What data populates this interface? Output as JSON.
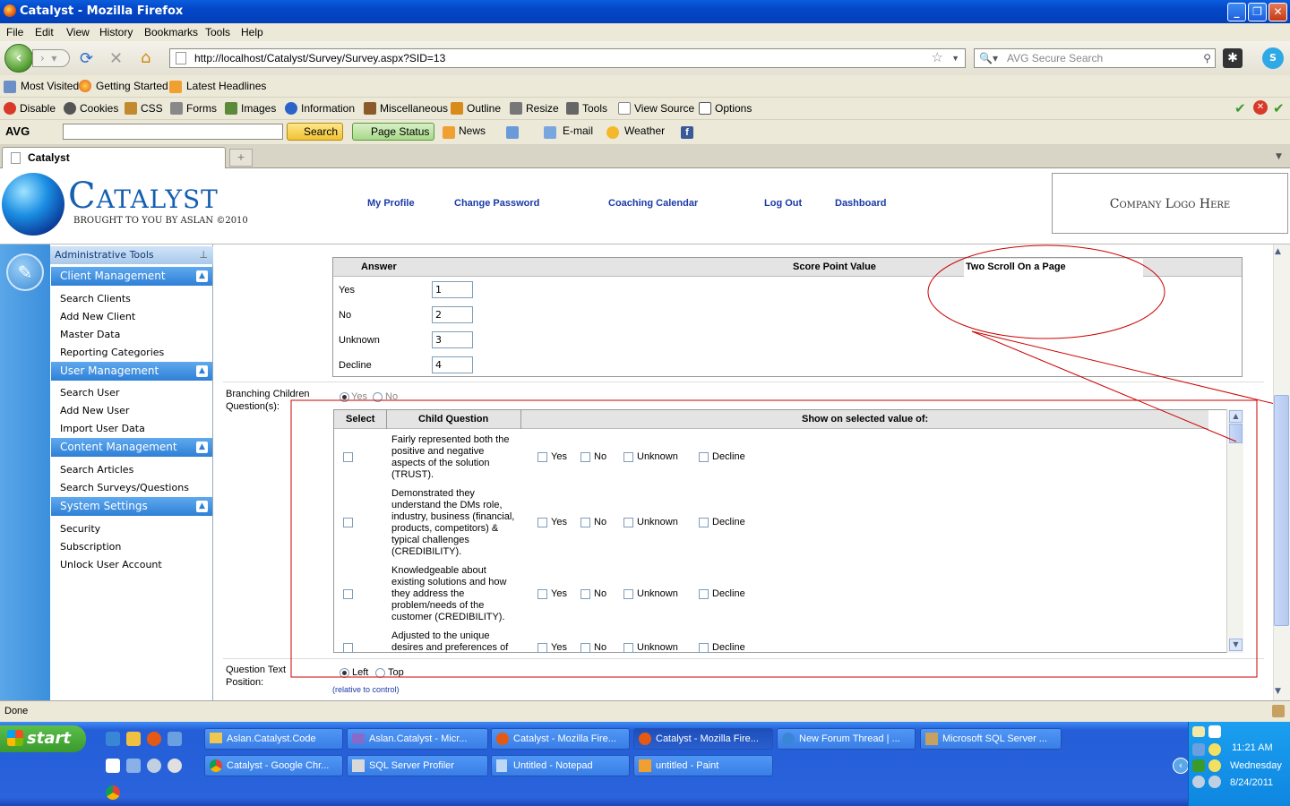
{
  "window": {
    "title": "Catalyst - Mozilla Firefox"
  },
  "menu": [
    "File",
    "Edit",
    "View",
    "History",
    "Bookmarks",
    "Tools",
    "Help"
  ],
  "nav": {
    "url": "http://localhost/Catalyst/Survey/Survey.aspx?SID=13",
    "search_placeholder": "AVG Secure Search"
  },
  "bookmarks": [
    "Most Visited",
    "Getting Started",
    "Latest Headlines"
  ],
  "devtoolbar": [
    "Disable",
    "Cookies",
    "CSS",
    "Forms",
    "Images",
    "Information",
    "Miscellaneous",
    "Outline",
    "Resize",
    "Tools",
    "View Source",
    "Options"
  ],
  "avgbar": {
    "brand": "AVG",
    "search": "Search",
    "page_status": "Page Status",
    "news": "News",
    "email": "E-mail",
    "weather": "Weather"
  },
  "tab": {
    "label": "Catalyst"
  },
  "header": {
    "brand": "Catalyst",
    "tagline": "BROUGHT TO YOU BY ASLAN ©2010",
    "links": [
      "My Profile",
      "Change Password",
      "Coaching Calendar",
      "Log Out",
      "Dashboard"
    ],
    "company_logo": "Company Logo Here"
  },
  "sidebar": {
    "title": "Administrative Tools",
    "sections": [
      {
        "label": "Client Management",
        "items": [
          "Search Clients",
          "Add New Client",
          "Master Data",
          "Reporting Categories"
        ]
      },
      {
        "label": "User Management",
        "items": [
          "Search User",
          "Add New User",
          "Import User Data"
        ]
      },
      {
        "label": "Content Management",
        "items": [
          "Search Articles",
          "Search Surveys/Questions"
        ]
      },
      {
        "label": "System Settings",
        "items": [
          "Security",
          "Subscription",
          "Unlock User Account"
        ]
      }
    ]
  },
  "answers": {
    "col_answer": "Answer",
    "col_score": "Score Point Value",
    "annotation": "Two Scroll On a Page",
    "rows": [
      {
        "label": "Yes",
        "value": "1"
      },
      {
        "label": "No",
        "value": "2"
      },
      {
        "label": "Unknown",
        "value": "3"
      },
      {
        "label": "Decline",
        "value": "4"
      }
    ]
  },
  "branching": {
    "label": "Branching Children Question(s):",
    "yes": "Yes",
    "no": "No",
    "col_select": "Select",
    "col_child": "Child Question",
    "col_show": "Show on selected value of:",
    "options": [
      "Yes",
      "No",
      "Unknown",
      "Decline"
    ],
    "questions": [
      "Fairly represented both the positive and negative aspects of the solution (TRUST).",
      "Demonstrated they understand the DMs role, industry, business (financial, products, competitors) & typical challenges (CREDIBILITY).",
      "Knowledgeable about existing solutions and how they address the problem/needs of the customer (CREDIBILITY).",
      "Adjusted to the unique desires and preferences of"
    ]
  },
  "position": {
    "label": "Question Text Position:",
    "left": "Left",
    "top": "Top",
    "note": "(relative to control)"
  },
  "status": {
    "text": "Done"
  },
  "taskbar": {
    "start": "start",
    "row1": [
      "Aslan.Catalyst.Code",
      "Aslan.Catalyst - Micr...",
      "Catalyst - Mozilla Fire...",
      "Catalyst - Mozilla Fire...",
      "New Forum Thread | ...",
      "Microsoft SQL Server ..."
    ],
    "row2": [
      "Catalyst - Google Chr...",
      "SQL Server Profiler",
      "Untitled - Notepad",
      "untitled - Paint"
    ],
    "time": "11:21 AM",
    "day": "Wednesday",
    "date": "8/24/2011"
  },
  "colors": {
    "titlebar": "#0346c7",
    "sidebar_header": "#2e7fd6",
    "link": "#1a3aa8",
    "annotation": "#cc0000"
  }
}
